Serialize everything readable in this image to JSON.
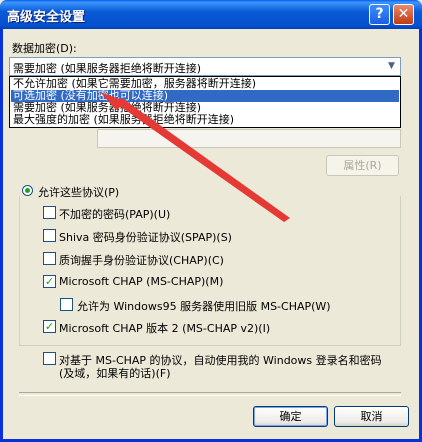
{
  "window": {
    "title": "高级安全设置",
    "help_label": "?",
    "close_label": "✕"
  },
  "encryption": {
    "label": "数据加密(D):",
    "selected": "需要加密 (如果服务器拒绝将断开连接)",
    "options": [
      "不允许加密 (如果它需要加密，服务器将断开连接)",
      "可选加密 (没有加密也可以连接)",
      "需要加密 (如果服务器拒绝将断开连接)",
      "最大强度的加密 (如果服务器拒绝将断开连接)"
    ],
    "highlighted_index": 1
  },
  "properties_button": "属性(R)",
  "protocols": {
    "radio_label": "允许这些协议(P)",
    "items": [
      {
        "label": "不加密的密码(PAP)(U)",
        "checked": false
      },
      {
        "label": "Shiva 密码身份验证协议(SPAP)(S)",
        "checked": false
      },
      {
        "label": "质询握手身份验证协议(CHAP)(C)",
        "checked": false
      },
      {
        "label": "Microsoft CHAP (MS-CHAP)(M)",
        "checked": true
      },
      {
        "label": "允许为 Windows95 服务器使用旧版 MS-CHAP(W)",
        "checked": false
      },
      {
        "label": "Microsoft CHAP 版本 2 (MS-CHAP v2)(I)",
        "checked": true
      }
    ]
  },
  "auto_logon": {
    "line1": "对基于 MS-CHAP 的协议，自动使用我的 Windows 登录名和密码",
    "line2": "(及域，如果有的话)(F)",
    "checked": false
  },
  "buttons": {
    "ok": "确定",
    "cancel": "取消"
  },
  "check_mark": "✓",
  "colors": {
    "title_bar": "#0a5ad6",
    "selection": "#316ac5",
    "annotation_arrow": "#e53935"
  }
}
